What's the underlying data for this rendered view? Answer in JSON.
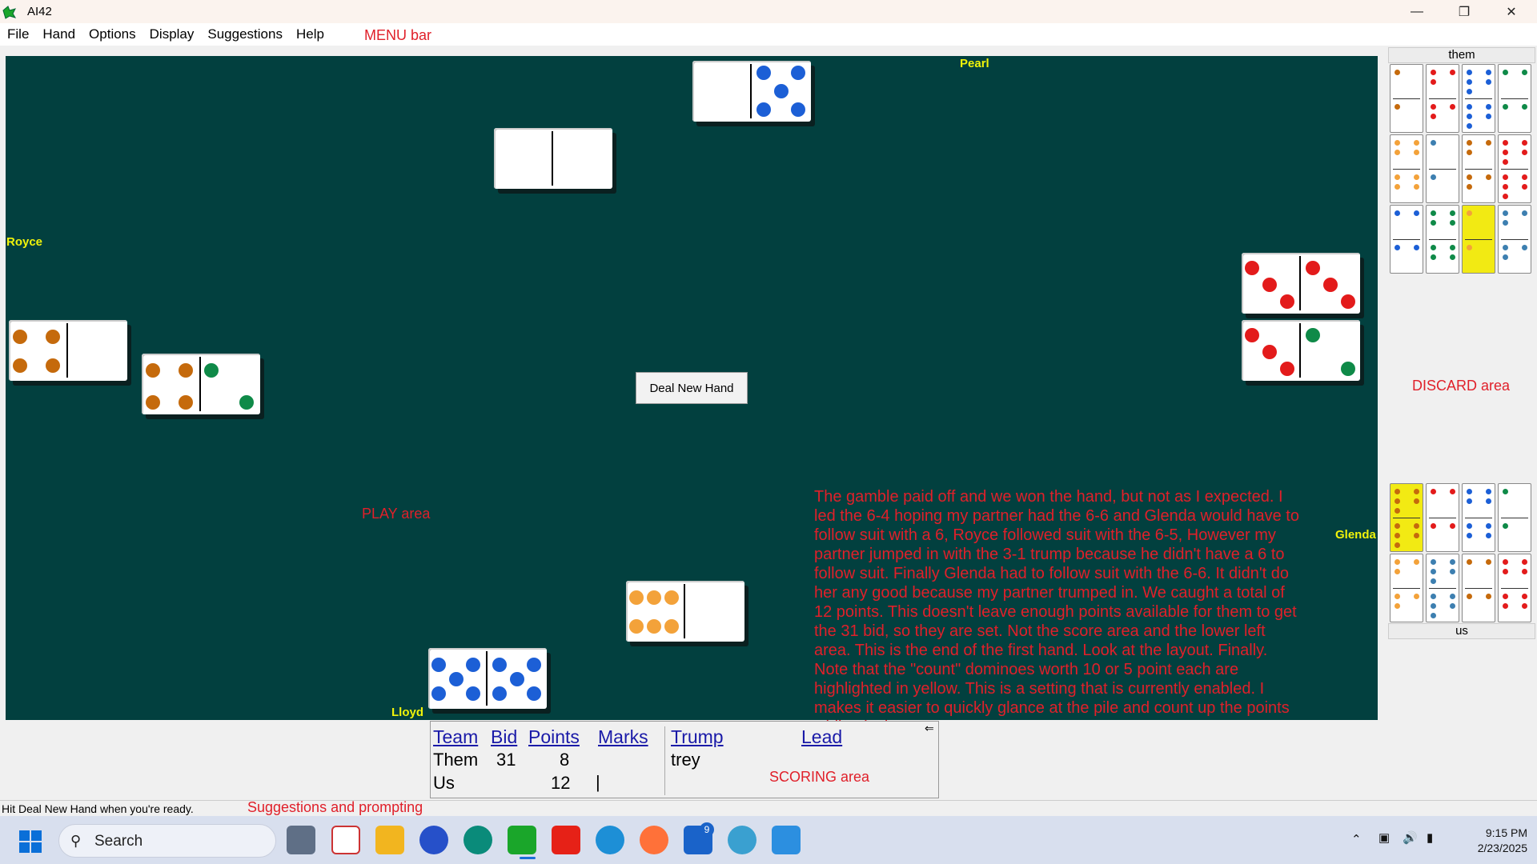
{
  "window": {
    "title": "AI42"
  },
  "menu": {
    "items": [
      "File",
      "Hand",
      "Options",
      "Display",
      "Suggestions",
      "Help"
    ],
    "note": "MENU bar"
  },
  "players": {
    "top": "Pearl",
    "left": "Royce",
    "right": "Glenda",
    "bottom": "Lloyd"
  },
  "play_area": {
    "note": "PLAY area",
    "deal_button": "Deal New Hand",
    "narrative": "The gamble paid off and we won the hand, but not as I expected. I led the 6-4 hoping my partner had the 6-6 and Glenda would have to follow suit with a 6, Royce followed suit with the 6-5, However my partner jumped in with the 3-1 trump because he didn't have a 6 to follow suit. Finally Glenda had to follow suit with the 6-6. It didn't do her any good because my partner trumped in. We caught a total of 12 points. This doesn't leave enough points available for them to get the 31 bid, so they are set. Not the score area and the lower left area. This is the end of the first hand. Look at the layout. Finally. Note that the \"count\" dominoes worth 10 or 5 point each are highlighted in yellow. This is a setting that is currently enabled. I makes it easier to quickly glance at the pile and count up the points while playing."
  },
  "discard": {
    "them_label": "them",
    "us_label": "us",
    "note": "DISCARD area"
  },
  "scoring": {
    "headers": {
      "team": "Team",
      "bid": "Bid",
      "points": "Points",
      "marks": "Marks",
      "trump": "Trump",
      "lead": "Lead"
    },
    "rows": [
      {
        "team": "Them",
        "bid": "31",
        "points": "8",
        "marks": ""
      },
      {
        "team": "Us",
        "bid": "",
        "points": "12",
        "marks": "|"
      }
    ],
    "trump": "trey",
    "note": "SCORING area"
  },
  "status": {
    "message": "Hit  Deal New Hand  when you're ready.",
    "note": "Suggestions and prompting"
  },
  "taskbar": {
    "search": "Search",
    "time": "9:15 PM",
    "date": "2/23/2025",
    "mail_badge": "9"
  },
  "colors": {
    "felt": "#02403f",
    "player_name": "#f1f30a",
    "annotation": "#e0202a",
    "count_highlight": "#f2ea13"
  }
}
